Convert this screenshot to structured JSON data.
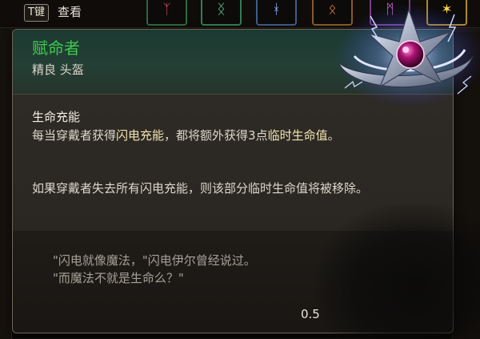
{
  "topbar": {
    "key_label": "T键",
    "look_label": "查看",
    "slot_glyphs": [
      "ᛉ",
      "ᛝ",
      "ᚼ",
      "ᛟ",
      "ᛗ",
      "✶"
    ]
  },
  "item": {
    "name": "赋命者",
    "rarity_type": "精良 头盔",
    "ability_title": "生命充能",
    "desc_part1": "每当穿戴者获得",
    "desc_hl1": "闪电充能",
    "desc_part2": "，都将额外获得3点",
    "desc_hl2": "临时生命值",
    "desc_part3": "。",
    "desc2": "如果穿戴者失去所有闪电充能，则该部分临时生命值将被移除。",
    "flavor_line1": "\"闪电就像魔法，\"闪电伊尔曾经说过。",
    "flavor_line2": "\"而魔法不就是生命么？\"",
    "weight": "0.5"
  },
  "colors": {
    "name_green": "#3fc94e",
    "highlight": "#f2e4b0",
    "header_bg": "#1b3a31"
  },
  "icons": {
    "item_art": "circlet-icon"
  }
}
